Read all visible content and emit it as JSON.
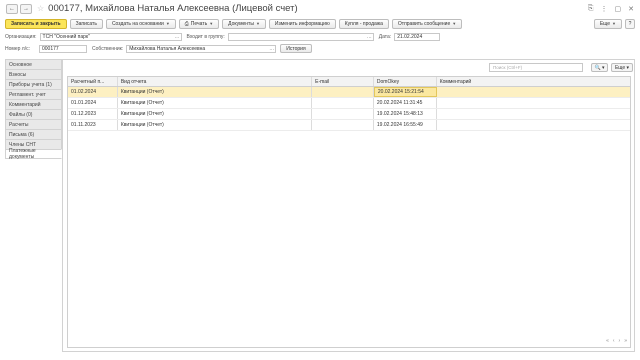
{
  "window": {
    "title": "000177, Михайлова Наталья Алексеевна (Лицевой счет)",
    "back": "←",
    "forward": "→",
    "star": "☆",
    "icons": [
      "⎘",
      "⋮",
      "▢",
      "✕"
    ]
  },
  "toolbar": {
    "save_close": "Записать и закрыть",
    "save": "Записать",
    "create_basis": "Создать на основании",
    "print": "Печать",
    "documents": "Документы",
    "change_info": "Изменить информацию",
    "buy_sell": "Купля - продажа",
    "send_message": "Отправить сообщение",
    "more": "Еще",
    "help": "?"
  },
  "form": {
    "org_label": "Организация:",
    "org_value": "ТСН \"Осенний парк\"",
    "group_label": "Входит в группу:",
    "group_value": "",
    "date_label": "Дата:",
    "date_value": "21.02.2024",
    "number_label": "Номер л/с:",
    "number_value": "000177",
    "owner_label": "Собственник:",
    "owner_value": "Михайлова Наталья Алексеевна",
    "history_btn": "История"
  },
  "tabs": [
    "Основное",
    "Взносы",
    "Приборы учета (1)",
    "Регламент. учет",
    "Комментарий",
    "Файлы (0)",
    "Расчеты",
    "Письма (6)",
    "Члены СНТ",
    "Платежные документы"
  ],
  "panel": {
    "search_placeholder": "Поиск (Ctrl+F)",
    "search_btn": "🔍 ▾",
    "more": "Еще ▾"
  },
  "grid": {
    "columns": [
      "Расчетный п...",
      "Вид отчета",
      "E-mail",
      "DomOkey",
      "Комментарий"
    ],
    "rows": [
      {
        "period": "01.02.2024",
        "type": "Квитанции (Отчет)",
        "email": "",
        "date": "20.02.2024 15:21:54",
        "comment": ""
      },
      {
        "period": "01.01.2024",
        "type": "Квитанции (Отчет)",
        "email": "",
        "date": "20.02.2024 11:31:45",
        "comment": ""
      },
      {
        "period": "01.12.2023",
        "type": "Квитанции (Отчет)",
        "email": "",
        "date": "19.02.2024 15:48:13",
        "comment": ""
      },
      {
        "period": "01.11.2023",
        "type": "Квитанции (Отчет)",
        "email": "",
        "date": "19.02.2024 16:55:49",
        "comment": ""
      }
    ],
    "nav": [
      "«",
      "‹",
      "›",
      "»"
    ]
  },
  "colors": {
    "accent": "#fbe55a",
    "selected_row": "#fdf0c2"
  }
}
